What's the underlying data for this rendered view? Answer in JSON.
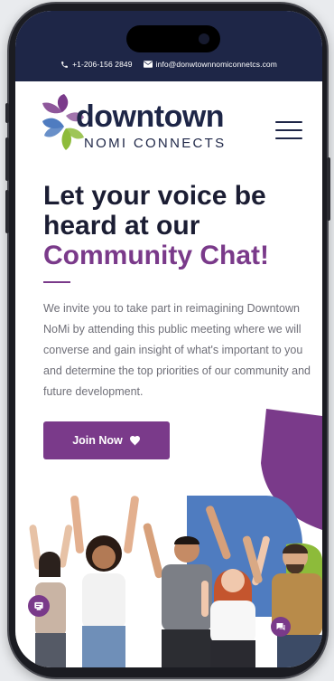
{
  "topbar": {
    "phone": "+1-206-156 2849",
    "email": "info@donwtownnomiconnetcs.com"
  },
  "logo": {
    "line1": "downtown",
    "line2": "NOMI CONNECTS"
  },
  "hero": {
    "title_line1": "Let your voice be",
    "title_line2": "heard at our",
    "title_accent": "Community Chat!",
    "intro": "We invite you to take part in reimagining Downtown NoMi by attending this public meeting where we will converse and gain insight of what's important to you and determine the top priorities of our community and future development.",
    "cta_label": "Join Now"
  },
  "colors": {
    "navy": "#1e2647",
    "purple": "#7a3a8a",
    "blue": "#4f7cc0",
    "green": "#8dbb3a"
  },
  "icons": [
    "phone-icon",
    "mail-icon",
    "heart-icon",
    "menu-icon",
    "accessibility-icon",
    "chat-icon"
  ]
}
